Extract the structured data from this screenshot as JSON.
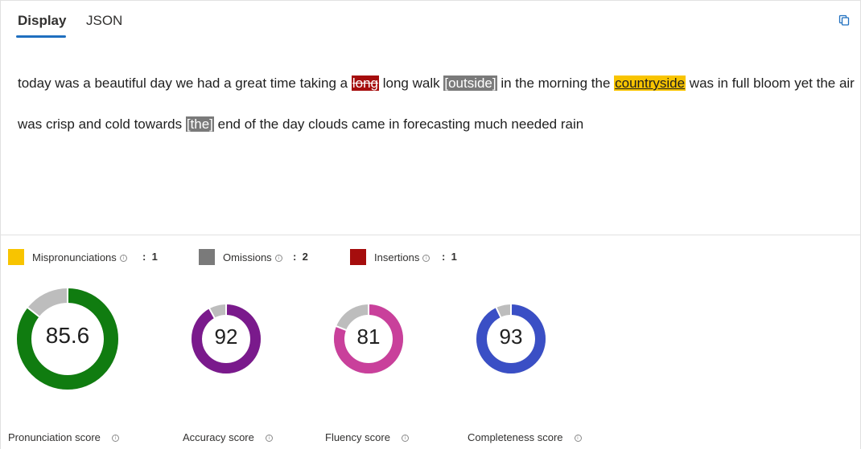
{
  "tabs": {
    "display": "Display",
    "json": "JSON"
  },
  "transcript": [
    {
      "t": "today was a beautiful day we had a great time taking a ",
      "k": "n"
    },
    {
      "t": "long",
      "k": "ins"
    },
    {
      "t": " long walk ",
      "k": "n"
    },
    {
      "t": "[outside]",
      "k": "omi"
    },
    {
      "t": " in the morning the ",
      "k": "n"
    },
    {
      "t": "countryside",
      "k": "mis"
    },
    {
      "t": " was in full bloom yet the air was crisp and cold towards ",
      "k": "n"
    },
    {
      "t": "[the]",
      "k": "omi"
    },
    {
      "t": " end of the day clouds came in forecasting much needed rain",
      "k": "n"
    }
  ],
  "legend": {
    "mispronunciations": {
      "label": "Mispronunciations",
      "count": "1",
      "color": "#f8c400"
    },
    "omissions": {
      "label": "Omissions",
      "count": "2",
      "color": "#7a7a7a"
    },
    "insertions": {
      "label": "Insertions",
      "count": "1",
      "color": "#a50d0d"
    }
  },
  "legend_separator": ":",
  "scores": [
    {
      "label": "Pronunciation score",
      "value": "85.6",
      "fraction": 0.856,
      "color": "#107c10"
    },
    {
      "label": "Accuracy score",
      "value": "92",
      "fraction": 0.92,
      "color": "#7a1a8c"
    },
    {
      "label": "Fluency score",
      "value": "81",
      "fraction": 0.81,
      "color": "#c9409b"
    },
    {
      "label": "Completeness score",
      "value": "93",
      "fraction": 0.93,
      "color": "#3a4fc5"
    }
  ],
  "icons": {
    "copy": "copy-icon",
    "info": "info-icon"
  }
}
